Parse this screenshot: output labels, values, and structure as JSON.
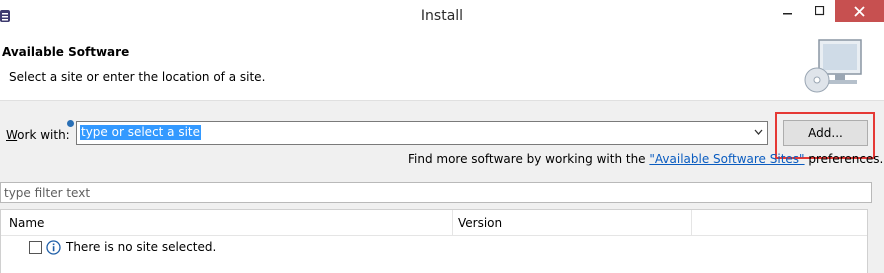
{
  "window": {
    "title": "Install",
    "buttons": [
      "minimize",
      "maximize",
      "close"
    ]
  },
  "header": {
    "title": "Available Software",
    "description": "Select a site or enter the location of a site."
  },
  "work_with": {
    "label_mnemonic": "W",
    "label_rest": "ork with:",
    "value": "type or select a site",
    "add_button": "Add..."
  },
  "find_more": {
    "prefix": "Find more software by working with the ",
    "link": "\"Available Software Sites\"",
    "suffix": " preferences."
  },
  "filter": {
    "placeholder": "type filter text"
  },
  "table": {
    "columns": [
      "Name",
      "Version"
    ],
    "rows": [
      {
        "name": "There is no site selected.",
        "checked": false
      }
    ]
  },
  "colors": {
    "close_button": "#c75050",
    "selection": "#3399ff",
    "link": "#0a5cc0",
    "highlight_box": "#e53935"
  }
}
